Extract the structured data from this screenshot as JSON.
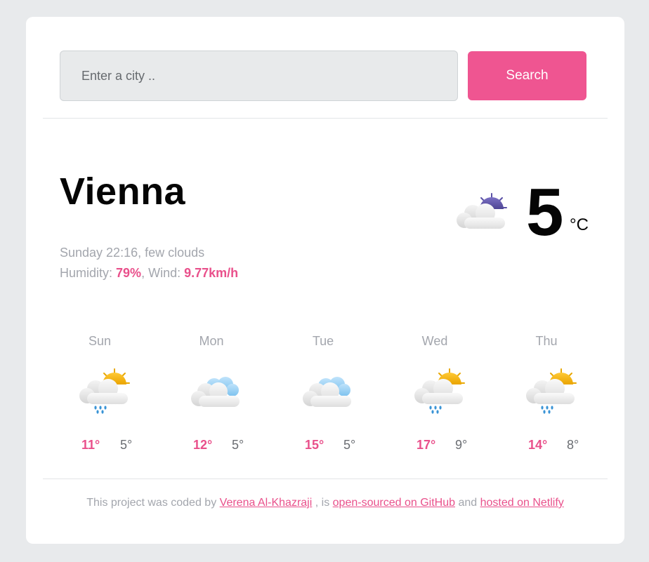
{
  "search": {
    "placeholder": "Enter a city ..",
    "value": "",
    "button_label": "Search"
  },
  "current": {
    "city": "Vienna",
    "datetime": "Sunday 22:16",
    "description": "few clouds",
    "humidity_label": "Humidity:",
    "humidity": "79%",
    "wind_label": "Wind:",
    "wind": "9.77km/h",
    "temperature": "5",
    "unit": "°C",
    "icon": "few-clouds-night-icon"
  },
  "forecast": [
    {
      "day": "Sun",
      "max": "11°",
      "min": "5°",
      "icon": "rain-sun-cloud-icon"
    },
    {
      "day": "Mon",
      "max": "12°",
      "min": "5°",
      "icon": "clouds-icon"
    },
    {
      "day": "Tue",
      "max": "15°",
      "min": "5°",
      "icon": "clouds-icon"
    },
    {
      "day": "Wed",
      "max": "17°",
      "min": "9°",
      "icon": "rain-sun-cloud-icon"
    },
    {
      "day": "Thu",
      "max": "14°",
      "min": "8°",
      "icon": "rain-sun-cloud-icon"
    }
  ],
  "footer": {
    "prefix": "This project was coded by",
    "author": "Verena Al-Khazraji",
    "middle": ", is",
    "github": "open-sourced on GitHub",
    "and": "and",
    "netlify": "hosted on Netlify"
  },
  "colors": {
    "accent": "#ef5591",
    "page_bg": "#e8eaec",
    "card_bg": "#ffffff",
    "muted_text": "#a3a6ad"
  }
}
